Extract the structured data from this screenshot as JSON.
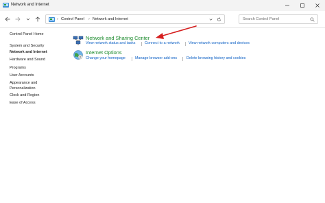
{
  "window": {
    "title": "Network and Internet",
    "controls": [
      "minimize-icon",
      "maximize-icon",
      "close-icon"
    ]
  },
  "toolbar": {
    "nav_icons": [
      "back-arrow-icon",
      "forward-arrow-icon",
      "chevron-down-icon",
      "up-arrow-icon"
    ],
    "breadcrumb": [
      "Control Panel",
      "Network and Internet"
    ],
    "search_placeholder": "Search Control Panel"
  },
  "sidebar": {
    "items": [
      {
        "label": "Control Panel Home",
        "current": false
      },
      {
        "label": "System and Security",
        "current": false
      },
      {
        "label": "Network and Internet",
        "current": true
      },
      {
        "label": "Hardware and Sound",
        "current": false
      },
      {
        "label": "Programs",
        "current": false
      },
      {
        "label": "User Accounts",
        "current": false
      },
      {
        "label": "Appearance and",
        "current": false
      },
      {
        "label": "Personalization",
        "current": false
      },
      {
        "label": "Clock and Region",
        "current": false
      },
      {
        "label": "Ease of Access",
        "current": false
      }
    ]
  },
  "categories": [
    {
      "title": "Network and Sharing Center",
      "icon": "network-sharing-icon",
      "tasks": [
        "View network status and tasks",
        "Connect to a network",
        "View network computers and devices"
      ]
    },
    {
      "title": "Internet Options",
      "icon": "internet-options-globe-icon",
      "tasks": [
        "Change your homepage",
        "Manage browser add-ons",
        "Delete browsing history and cookies"
      ]
    }
  ],
  "colors": {
    "category_title": "#1a8a2b",
    "task_link": "#0a5ec4",
    "annotation_arrow": "#d62020",
    "titlebar_bg": "#f3f3f3"
  }
}
